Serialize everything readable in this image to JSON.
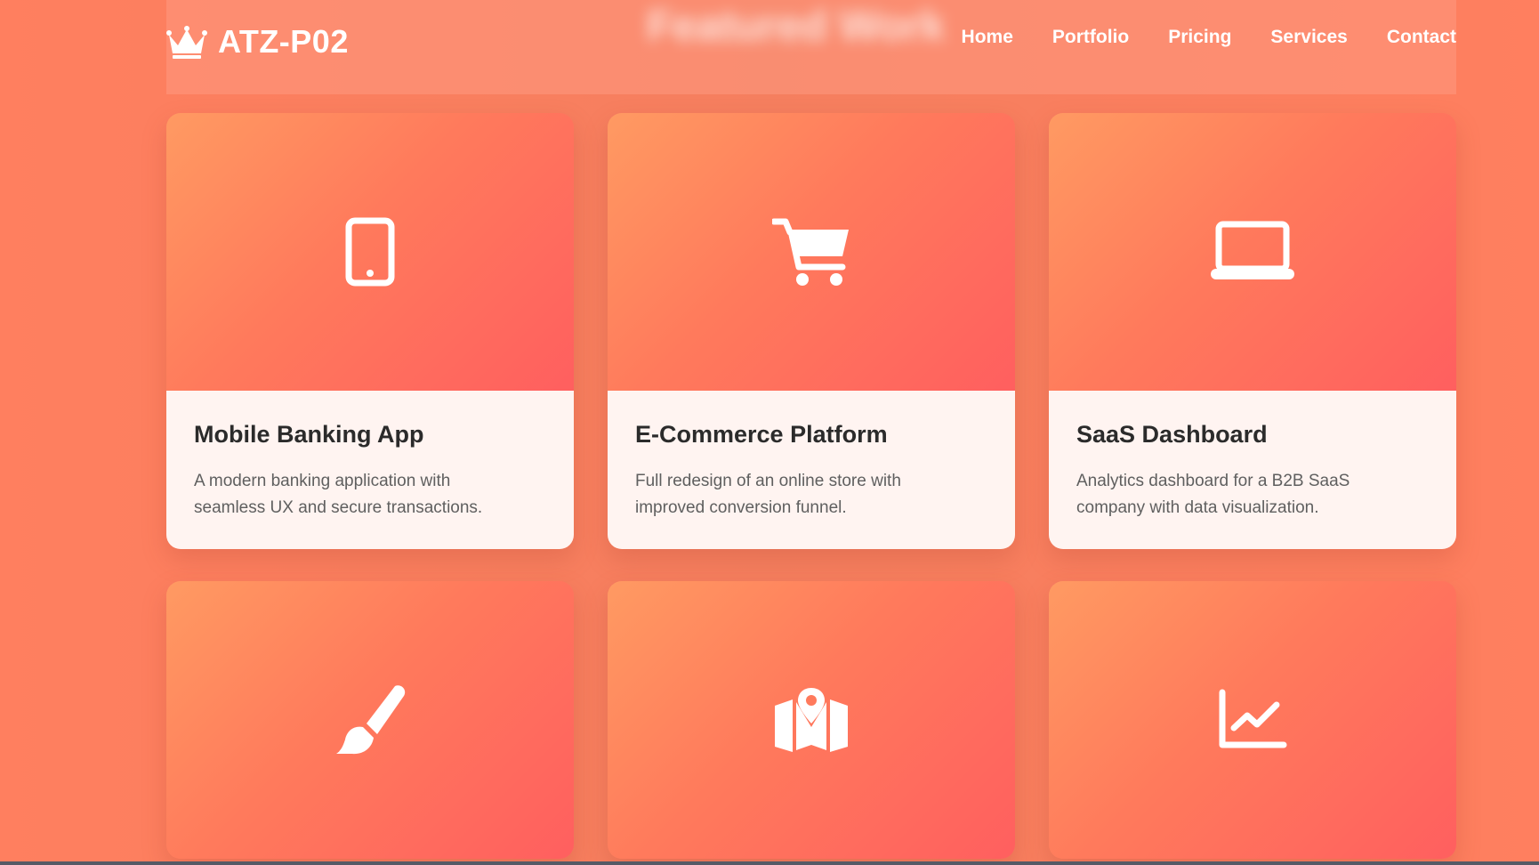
{
  "header": {
    "brand": "ATZ-P02",
    "ghost_title": "Featured Work",
    "nav": [
      "Home",
      "Portfolio",
      "Pricing",
      "Services",
      "Contact"
    ]
  },
  "colors": {
    "page_background": "#ff7f5f",
    "card_gradient_start": "#ff9a62",
    "card_gradient_end": "#ff5f5f",
    "card_body": "#fff4f1",
    "title_text": "#2b2b2b",
    "description_text": "#5f5f5f"
  },
  "cards": [
    {
      "icon": "mobile-phone-icon",
      "title": "Mobile Banking App",
      "desc_line1": "A modern banking application with",
      "desc_line2": "seamless UX and secure transactions."
    },
    {
      "icon": "shopping-cart-icon",
      "title": "E-Commerce Platform",
      "desc_line1": "Full redesign of an online store with",
      "desc_line2": "improved conversion funnel."
    },
    {
      "icon": "laptop-icon",
      "title": "SaaS Dashboard",
      "desc_line1": "Analytics dashboard for a B2B SaaS",
      "desc_line2": "company with data visualization."
    },
    {
      "icon": "paintbrush-icon"
    },
    {
      "icon": "map-location-icon"
    },
    {
      "icon": "line-chart-icon"
    }
  ]
}
